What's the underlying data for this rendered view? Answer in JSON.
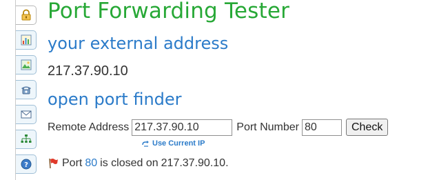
{
  "header": {
    "title": "Port Forwarding Tester"
  },
  "external_address": {
    "heading": "your external address",
    "ip": "217.37.90.10"
  },
  "port_finder": {
    "heading": "open port finder",
    "remote_address_label": "Remote Address",
    "remote_address_value": "217.37.90.10",
    "port_number_label": "Port Number",
    "port_number_value": "80",
    "check_label": "Check",
    "use_current_ip_label": "Use Current IP"
  },
  "result": {
    "prefix": "Port",
    "port": "80",
    "middle": "is closed on",
    "ip": "217.37.90.10."
  },
  "tabs": [
    {
      "icon": "lock-icon"
    },
    {
      "icon": "chart-icon"
    },
    {
      "icon": "image-icon"
    },
    {
      "icon": "phone-icon"
    },
    {
      "icon": "mail-icon"
    },
    {
      "icon": "network-icon"
    },
    {
      "icon": "help-icon"
    }
  ],
  "colors": {
    "title_green": "#27a836",
    "heading_blue": "#2b7bc9",
    "text": "#333333"
  }
}
